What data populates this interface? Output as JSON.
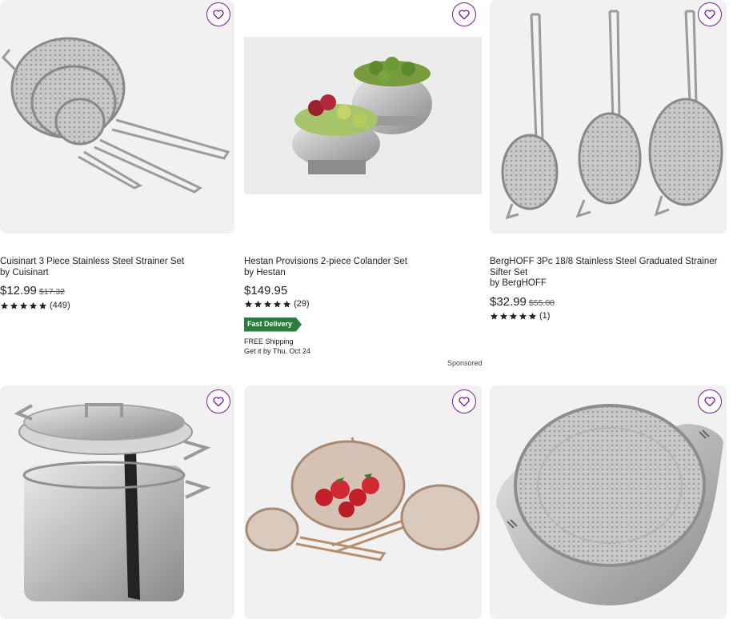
{
  "products": [
    {
      "title": "Cuisinart 3 Piece Stainless Steel Strainer Set",
      "by": "by Cuisinart",
      "price": "$12.99",
      "was": "$17.32",
      "rating_count": "(449)",
      "rating": 5,
      "favorite_icon": "heart-icon"
    },
    {
      "title": "Hestan Provisions 2-piece Colander Set",
      "by": "by Hestan",
      "price": "$149.95",
      "was": "",
      "rating_count": "(29)",
      "rating": 5,
      "badge": "Fast Delivery",
      "shipping": "FREE Shipping",
      "delivery": "Get it by Thu. Oct 24",
      "sponsored": "Sponsored",
      "favorite_icon": "heart-icon"
    },
    {
      "title": "BergHOFF 3Pc 18/8 Stainless Steel Graduated Strainer Sifter Set",
      "by": "by BergHOFF",
      "price": "$32.99",
      "was": "$55.00",
      "rating_count": "(1)",
      "rating": 5,
      "favorite_icon": "heart-icon"
    },
    {
      "title": "",
      "favorite_icon": "heart-icon"
    },
    {
      "title": "",
      "favorite_icon": "heart-icon"
    },
    {
      "title": "",
      "favorite_icon": "heart-icon"
    }
  ],
  "colors": {
    "accent": "#7b189f",
    "badge": "#2a7d3b",
    "tile": "#f1f1f1"
  }
}
